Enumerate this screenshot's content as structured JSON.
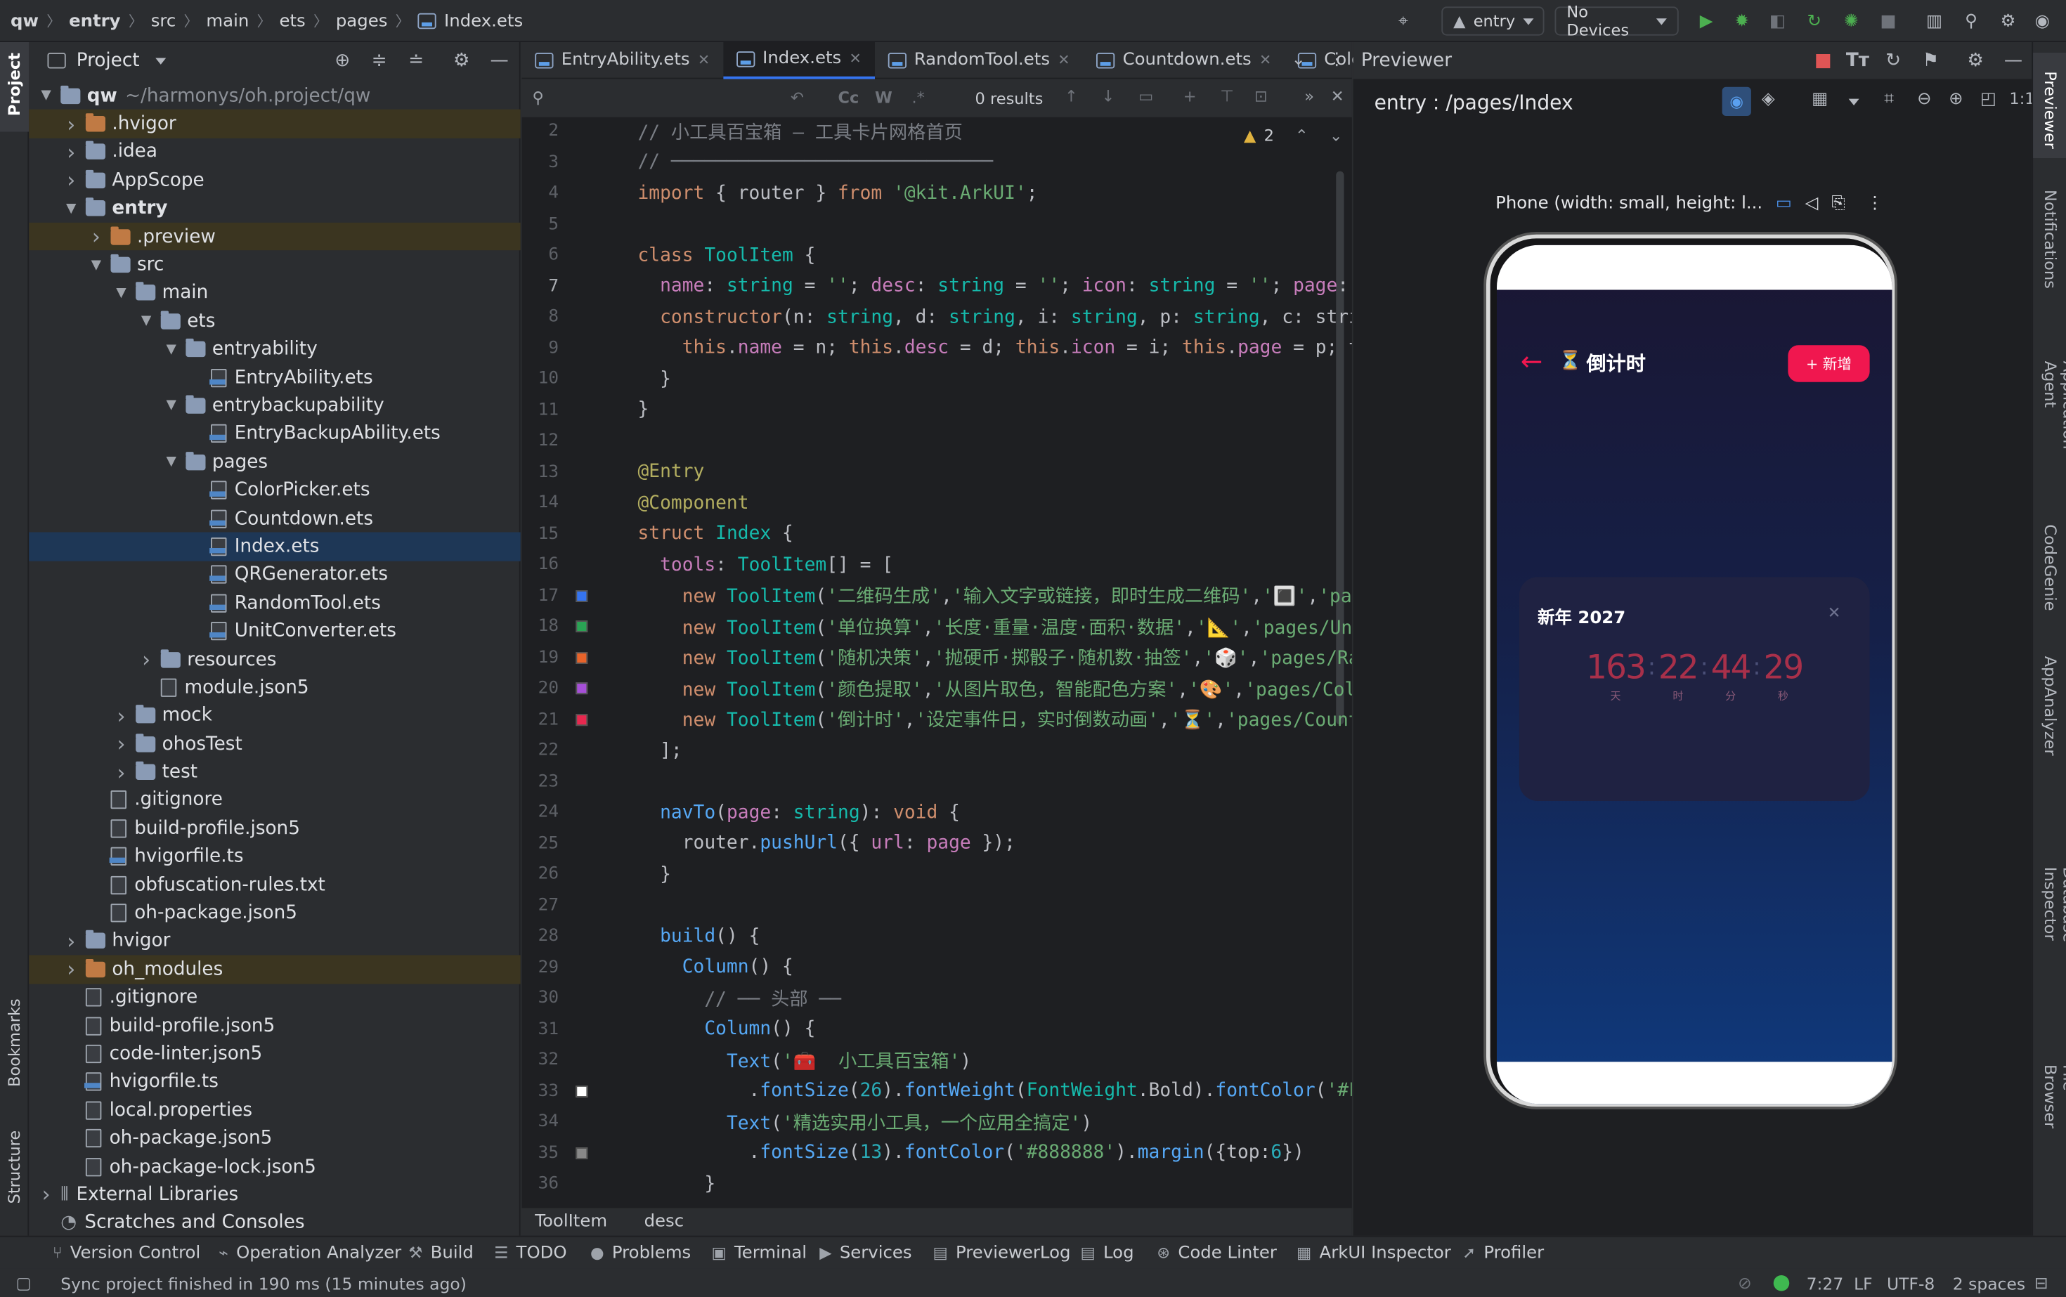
{
  "breadcrumb": [
    "qw",
    "entry",
    "src",
    "main",
    "ets",
    "pages",
    "Index.ets"
  ],
  "toolbar": {
    "run_config": "entry",
    "device": "No Devices",
    "run_color": "#4caf50",
    "icons": [
      "target-icon",
      "run-icon",
      "debug-icon",
      "attach-icon",
      "reload-icon",
      "profile-icon",
      "stop-icon",
      "project-structure-icon",
      "search-icon",
      "settings-icon"
    ]
  },
  "left_strip": {
    "top": "Project",
    "bookmarks": "Bookmarks",
    "structure": "Structure"
  },
  "project": {
    "title": "Project",
    "root_name": "qw",
    "root_path": "~/harmonys/oh.project/qw",
    "items": [
      {
        "label": ".hvigor",
        "depth": 1,
        "kind": "folder-orange",
        "chev": "right",
        "hl": true
      },
      {
        "label": ".idea",
        "depth": 1,
        "kind": "folder",
        "chev": "right"
      },
      {
        "label": "AppScope",
        "depth": 1,
        "kind": "folder",
        "chev": "right"
      },
      {
        "label": "entry",
        "depth": 1,
        "kind": "folder",
        "chev": "down",
        "bold": true
      },
      {
        "label": ".preview",
        "depth": 2,
        "kind": "folder-orange",
        "chev": "right",
        "hl": true
      },
      {
        "label": "src",
        "depth": 2,
        "kind": "folder",
        "chev": "down"
      },
      {
        "label": "main",
        "depth": 3,
        "kind": "folder",
        "chev": "down"
      },
      {
        "label": "ets",
        "depth": 4,
        "kind": "folder",
        "chev": "down"
      },
      {
        "label": "entryability",
        "depth": 5,
        "kind": "folder",
        "chev": "down"
      },
      {
        "label": "EntryAbility.ets",
        "depth": 6,
        "kind": "ets"
      },
      {
        "label": "entrybackupability",
        "depth": 5,
        "kind": "folder",
        "chev": "down"
      },
      {
        "label": "EntryBackupAbility.ets",
        "depth": 6,
        "kind": "ets"
      },
      {
        "label": "pages",
        "depth": 5,
        "kind": "folder",
        "chev": "down"
      },
      {
        "label": "ColorPicker.ets",
        "depth": 6,
        "kind": "ets"
      },
      {
        "label": "Countdown.ets",
        "depth": 6,
        "kind": "ets"
      },
      {
        "label": "Index.ets",
        "depth": 6,
        "kind": "ets",
        "selected": true
      },
      {
        "label": "QRGenerator.ets",
        "depth": 6,
        "kind": "ets"
      },
      {
        "label": "RandomTool.ets",
        "depth": 6,
        "kind": "ets"
      },
      {
        "label": "UnitConverter.ets",
        "depth": 6,
        "kind": "ets"
      },
      {
        "label": "resources",
        "depth": 4,
        "kind": "folder",
        "chev": "right"
      },
      {
        "label": "module.json5",
        "depth": 4,
        "kind": "file"
      },
      {
        "label": "mock",
        "depth": 3,
        "kind": "folder",
        "chev": "right"
      },
      {
        "label": "ohosTest",
        "depth": 3,
        "kind": "folder",
        "chev": "right"
      },
      {
        "label": "test",
        "depth": 3,
        "kind": "folder",
        "chev": "right"
      },
      {
        "label": ".gitignore",
        "depth": 2,
        "kind": "file"
      },
      {
        "label": "build-profile.json5",
        "depth": 2,
        "kind": "file"
      },
      {
        "label": "hvigorfile.ts",
        "depth": 2,
        "kind": "ets"
      },
      {
        "label": "obfuscation-rules.txt",
        "depth": 2,
        "kind": "file"
      },
      {
        "label": "oh-package.json5",
        "depth": 2,
        "kind": "file"
      },
      {
        "label": "hvigor",
        "depth": 1,
        "kind": "folder",
        "chev": "right"
      },
      {
        "label": "oh_modules",
        "depth": 1,
        "kind": "folder-orange",
        "chev": "right",
        "hl": true
      },
      {
        "label": ".gitignore",
        "depth": 1,
        "kind": "file"
      },
      {
        "label": "build-profile.json5",
        "depth": 1,
        "kind": "file"
      },
      {
        "label": "code-linter.json5",
        "depth": 1,
        "kind": "file"
      },
      {
        "label": "hvigorfile.ts",
        "depth": 1,
        "kind": "ets"
      },
      {
        "label": "local.properties",
        "depth": 1,
        "kind": "file"
      },
      {
        "label": "oh-package.json5",
        "depth": 1,
        "kind": "file"
      },
      {
        "label": "oh-package-lock.json5",
        "depth": 1,
        "kind": "file"
      },
      {
        "label": "External Libraries",
        "depth": 0,
        "kind": "lib",
        "chev": "right"
      },
      {
        "label": "Scratches and Consoles",
        "depth": 0,
        "kind": "scratch"
      }
    ]
  },
  "editor": {
    "tabs": [
      {
        "label": "EntryAbility.ets"
      },
      {
        "label": "Index.ets",
        "active": true
      },
      {
        "label": "RandomTool.ets"
      },
      {
        "label": "Countdown.ets"
      },
      {
        "label": "Colo"
      }
    ],
    "find_results": "0 results",
    "find_toggles": [
      "Cc",
      "W",
      ".*"
    ],
    "warnings": "2",
    "breadcrumb": [
      "ToolItem",
      "desc"
    ],
    "lines": [
      {
        "n": 2,
        "t": "// 小工具百宝箱 — 工具卡片网格首页",
        "c": "cm"
      },
      {
        "n": 3,
        "t": "// ─────────────────────────────",
        "c": "cm"
      },
      {
        "n": 4,
        "t": "import { router } from '@kit.ArkUI';"
      },
      {
        "n": 5,
        "t": ""
      },
      {
        "n": 6,
        "t": "class ToolItem {"
      },
      {
        "n": 7,
        "t": "  name: string = ''; desc: string = ''; icon: string = ''; page:",
        "cur": true
      },
      {
        "n": 8,
        "t": "  constructor(n: string, d: string, i: string, p: string, c: stri"
      },
      {
        "n": 9,
        "t": "    this.name = n; this.desc = d; this.icon = i; this.page = p; t"
      },
      {
        "n": 10,
        "t": "  }"
      },
      {
        "n": 11,
        "t": "}"
      },
      {
        "n": 12,
        "t": ""
      },
      {
        "n": 13,
        "t": "@Entry",
        "c": "an"
      },
      {
        "n": 14,
        "t": "@Component",
        "c": "an"
      },
      {
        "n": 15,
        "t": "struct Index {"
      },
      {
        "n": 16,
        "t": "  tools: ToolItem[] = ["
      },
      {
        "n": 17,
        "t": "    new ToolItem('二维码生成','输入文字或链接，即时生成二维码','🔳','pag",
        "sw": "#3574f0"
      },
      {
        "n": 18,
        "t": "    new ToolItem('单位换算','长度·重量·温度·面积·数据','📐','pages/Uni",
        "sw": "#2aa354"
      },
      {
        "n": 19,
        "t": "    new ToolItem('随机决策','抛硬币·掷骰子·随机数·抽签','🎲','pages/Ra",
        "sw": "#e8632a"
      },
      {
        "n": 20,
        "t": "    new ToolItem('颜色提取','从图片取色，智能配色方案','🎨','pages/Col",
        "sw": "#a64fd8"
      },
      {
        "n": 21,
        "t": "    new ToolItem('倒计时','设定事件日，实时倒数动画','⏳','pages/Count",
        "sw": "#e8284f"
      },
      {
        "n": 22,
        "t": "  ];"
      },
      {
        "n": 23,
        "t": ""
      },
      {
        "n": 24,
        "t": "  navTo(page: string): void {"
      },
      {
        "n": 25,
        "t": "    router.pushUrl({ url: page });"
      },
      {
        "n": 26,
        "t": "  }"
      },
      {
        "n": 27,
        "t": ""
      },
      {
        "n": 28,
        "t": "  build() {"
      },
      {
        "n": 29,
        "t": "    Column() {"
      },
      {
        "n": 30,
        "t": "      // ── 头部 ──",
        "c": "cm"
      },
      {
        "n": 31,
        "t": "      Column() {"
      },
      {
        "n": 32,
        "t": "        Text('🧰  小工具百宝箱')"
      },
      {
        "n": 33,
        "t": "          .fontSize(26).fontWeight(FontWeight.Bold).fontColor('#F",
        "sw": "#ffffff"
      },
      {
        "n": 34,
        "t": "        Text('精选实用小工具，一个应用全搞定')"
      },
      {
        "n": 35,
        "t": "          .fontSize(13).fontColor('#888888').margin({top:6})",
        "sw": "#888888"
      },
      {
        "n": 36,
        "t": "      }"
      }
    ]
  },
  "previewer": {
    "title": "Previewer",
    "route": "entry : /pages/Index",
    "device_label": "Phone (width: small, height: l...",
    "app": {
      "back": "←",
      "icon": "⏳",
      "title": "倒计时",
      "add_button": "+ 新增",
      "accent": "#f0174f",
      "card_title": "新年 2027",
      "close": "✕",
      "countdown": [
        {
          "value": "163",
          "unit": "天"
        },
        {
          "value": "22",
          "unit": "时"
        },
        {
          "value": "44",
          "unit": "分"
        },
        {
          "value": "29",
          "unit": "秒"
        }
      ],
      "digit_color": "#a8304a"
    }
  },
  "right_strip": [
    "Previewer",
    "Notifications",
    "Application Agent",
    "CodeGenie",
    "AppAnalyzer",
    "Database Inspector",
    "Device File Browser"
  ],
  "tool_windows": [
    {
      "label": "Version Control",
      "icon": "vcs-icon",
      "glyph": "⑂"
    },
    {
      "label": "Operation Analyzer",
      "icon": "analyzer-icon",
      "glyph": "⌁"
    },
    {
      "label": "Build",
      "icon": "hammer-icon",
      "glyph": "⚒"
    },
    {
      "label": "TODO",
      "icon": "list-icon",
      "glyph": "☰"
    },
    {
      "label": "Problems",
      "icon": "problems-icon",
      "glyph": "●"
    },
    {
      "label": "Terminal",
      "icon": "terminal-icon",
      "glyph": "▣"
    },
    {
      "label": "Services",
      "icon": "services-icon",
      "glyph": "▶"
    },
    {
      "label": "PreviewerLog",
      "icon": "log-icon",
      "glyph": "▤"
    },
    {
      "label": "Log",
      "icon": "log-icon",
      "glyph": "▤"
    },
    {
      "label": "Code Linter",
      "icon": "linter-icon",
      "glyph": "⊛"
    },
    {
      "label": "ArkUI Inspector",
      "icon": "inspector-icon",
      "glyph": "▦"
    },
    {
      "label": "Profiler",
      "icon": "profiler-icon",
      "glyph": "➚"
    }
  ],
  "status": {
    "message": "Sync project finished in 190 ms (15 minutes ago)",
    "position": "7:27",
    "line_ending": "LF",
    "encoding": "UTF-8",
    "indent": "2 spaces"
  }
}
